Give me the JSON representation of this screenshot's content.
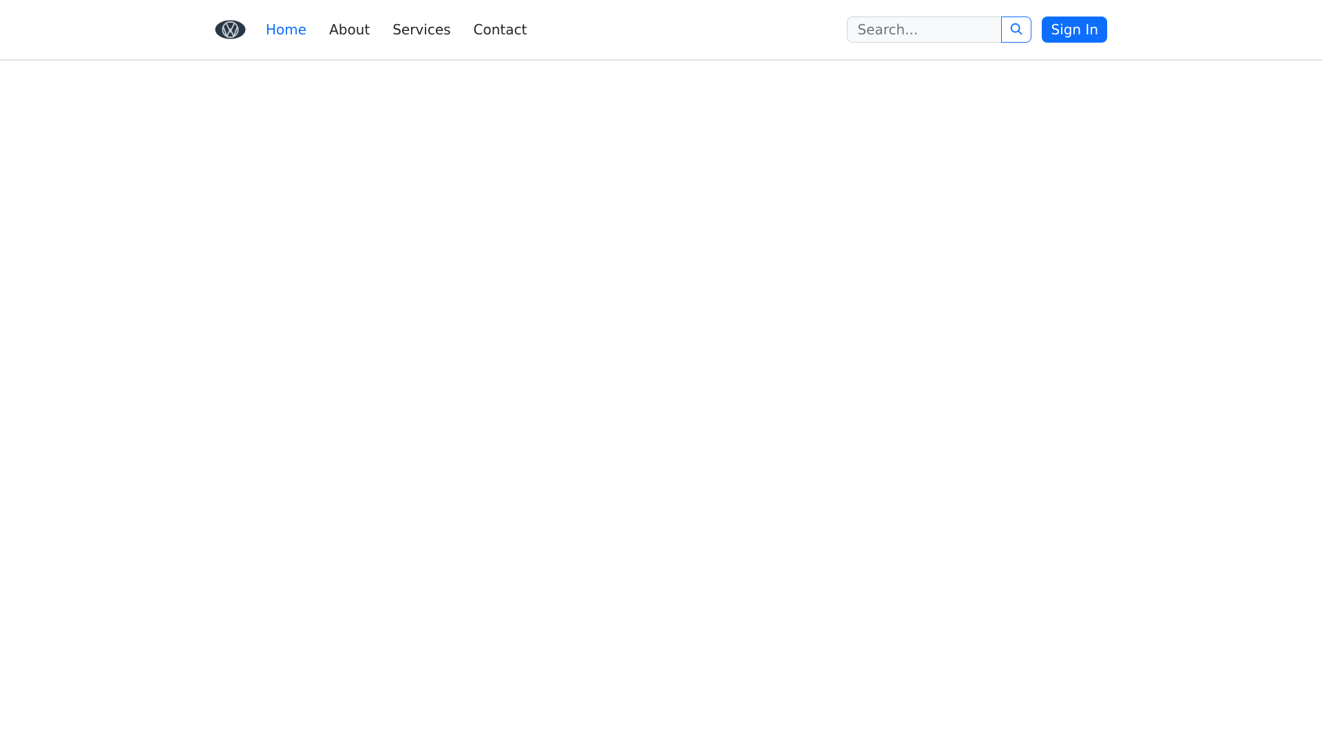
{
  "navbar": {
    "brand": {
      "logo_icon": "vw-logo-icon"
    },
    "links": [
      {
        "label": "Home",
        "active": true
      },
      {
        "label": "About",
        "active": false
      },
      {
        "label": "Services",
        "active": false
      },
      {
        "label": "Contact",
        "active": false
      }
    ],
    "search": {
      "placeholder": "Search...",
      "value": "",
      "button_icon": "search-icon"
    },
    "sign_in_label": "Sign In"
  },
  "colors": {
    "accent": "#0d6efd",
    "nav_text": "#212529",
    "placeholder": "#6c757d",
    "input_bg": "#f8f9fa",
    "input_border": "#ced4da",
    "navbar_border": "#dee2e6",
    "logo_bg": "#2a3845",
    "logo_mark": "#c9ced3"
  }
}
